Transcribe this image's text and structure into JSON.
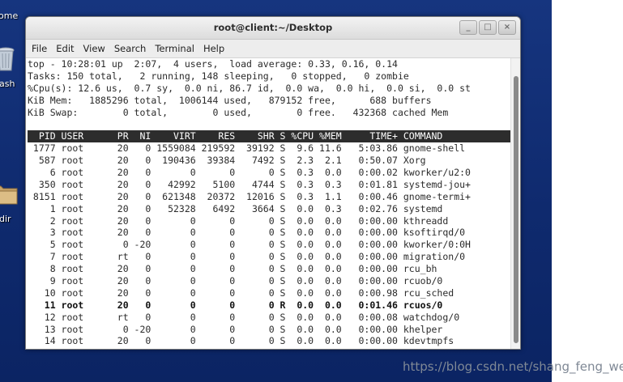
{
  "desktop": {
    "icons": [
      {
        "label": "ome",
        "icon": "home-icon"
      },
      {
        "label": "ash",
        "icon": "trash-icon"
      },
      {
        "label": "dir",
        "icon": "folder-icon"
      }
    ],
    "background": "#16357f"
  },
  "watermark": "https://blog.csdn.net/shang_feng_wei",
  "window": {
    "title": "root@client:~/Desktop",
    "controls": [
      "_",
      "□",
      "×"
    ],
    "menu": [
      "File",
      "Edit",
      "View",
      "Search",
      "Terminal",
      "Help"
    ]
  },
  "top": {
    "summary": [
      "top - 10:28:01 up  2:07,  4 users,  load average: 0.33, 0.16, 0.14",
      "Tasks: 150 total,   2 running, 148 sleeping,   0 stopped,   0 zombie",
      "%Cpu(s): 12.6 us,  0.7 sy,  0.0 ni, 86.7 id,  0.0 wa,  0.0 hi,  0.0 si,  0.0 st",
      "KiB Mem:   1885296 total,  1006144 used,   879152 free,      688 buffers",
      "KiB Swap:        0 total,        0 used,        0 free.   432368 cached Mem"
    ],
    "header": "  PID USER      PR  NI    VIRT    RES    SHR S %CPU %MEM     TIME+ COMMAND",
    "rows": [
      " 1777 root      20   0 1559084 219592  39192 S  9.6 11.6   5:03.86 gnome-shell",
      "  587 root      20   0  190436  39384   7492 S  2.3  2.1   0:50.07 Xorg",
      "    6 root      20   0       0      0      0 S  0.3  0.0   0:00.02 kworker/u2:0",
      "  350 root      20   0   42992   5100   4744 S  0.3  0.3   0:01.81 systemd-jou+",
      " 8151 root      20   0  621348  20372  12016 S  0.3  1.1   0:00.46 gnome-termi+",
      "    1 root      20   0   52328   6492   3664 S  0.0  0.3   0:02.76 systemd",
      "    2 root      20   0       0      0      0 S  0.0  0.0   0:00.00 kthreadd",
      "    3 root      20   0       0      0      0 S  0.0  0.0   0:00.00 ksoftirqd/0",
      "    5 root       0 -20       0      0      0 S  0.0  0.0   0:00.00 kworker/0:0H",
      "    7 root      rt   0       0      0      0 S  0.0  0.0   0:00.00 migration/0",
      "    8 root      20   0       0      0      0 S  0.0  0.0   0:00.00 rcu_bh",
      "    9 root      20   0       0      0      0 S  0.0  0.0   0:00.00 rcuob/0",
      "   10 root      20   0       0      0      0 S  0.0  0.0   0:00.98 rcu_sched",
      "   11 root      20   0       0      0      0 R  0.0  0.0   0:01.46 rcuos/0",
      "   12 root      rt   0       0      0      0 S  0.0  0.0   0:00.08 watchdog/0",
      "   13 root       0 -20       0      0      0 S  0.0  0.0   0:00.00 khelper",
      "   14 root      20   0       0      0      0 S  0.0  0.0   0:00.00 kdevtmpfs"
    ],
    "highlighted_row_index": 13,
    "header_bg": "#2d2d2d"
  }
}
